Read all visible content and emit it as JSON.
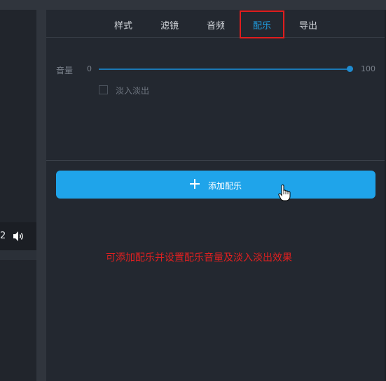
{
  "tabs": [
    {
      "label": "样式",
      "active": false
    },
    {
      "label": "滤镜",
      "active": false
    },
    {
      "label": "音频",
      "active": false
    },
    {
      "label": "配乐",
      "active": true
    },
    {
      "label": "导出",
      "active": false
    }
  ],
  "left_pane": {
    "number": "2",
    "volume_icon": "speaker-icon"
  },
  "volume": {
    "label": "音量",
    "min": "0",
    "max": "100",
    "value": 100
  },
  "fade": {
    "label": "淡入淡出",
    "checked": false
  },
  "add_music": {
    "label": "添加配乐",
    "icon": "plus-icon"
  },
  "annotation": {
    "hint": "可添加配乐并设置配乐音量及淡入淡出效果"
  },
  "colors": {
    "accent": "#1fa4ea",
    "highlight_box": "#e01d1d",
    "hint_text": "#e12020",
    "panel_bg": "#232830"
  }
}
